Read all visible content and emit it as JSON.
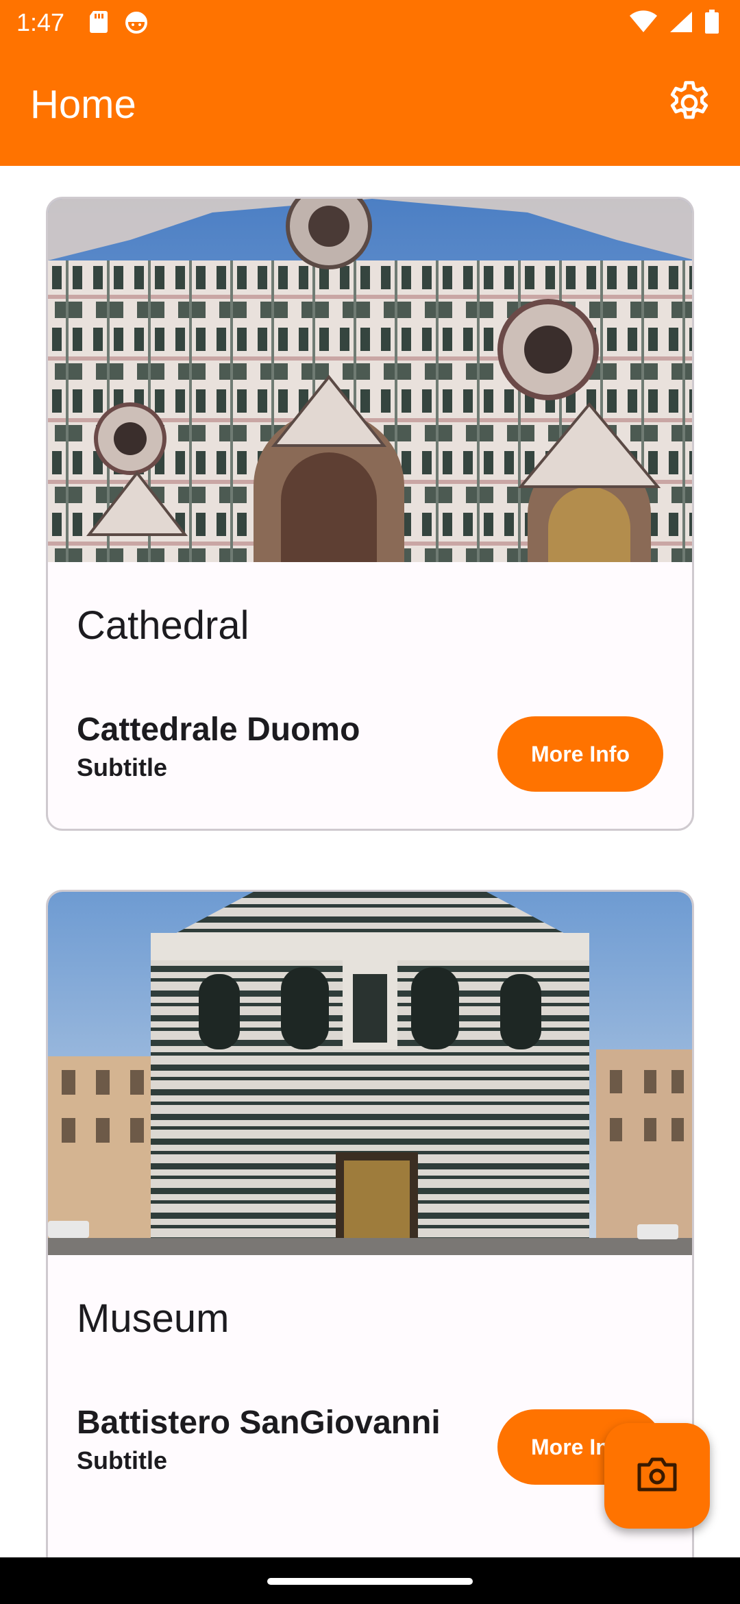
{
  "status_bar": {
    "time": "1:47",
    "left_icons": [
      "sd-card-icon",
      "android-face-icon"
    ],
    "right_icons": [
      "wifi-icon",
      "cellular-signal-icon",
      "battery-icon"
    ]
  },
  "app_bar": {
    "title": "Home",
    "settings_icon": "gear-icon",
    "background_color": "#ff7300"
  },
  "cards": [
    {
      "heading": "Cathedral",
      "title": "Cattedrale Duomo",
      "subtitle": "Subtitle",
      "button_label": "More Info"
    },
    {
      "heading": "Museum",
      "title": "Battistero SanGiovanni",
      "subtitle": "Subtitle",
      "button_label": "More Info"
    }
  ],
  "fab": {
    "icon": "camera-icon"
  },
  "colors": {
    "accent": "#ff7300",
    "card_bg": "#fffbfe",
    "card_border": "#cfcacf"
  }
}
